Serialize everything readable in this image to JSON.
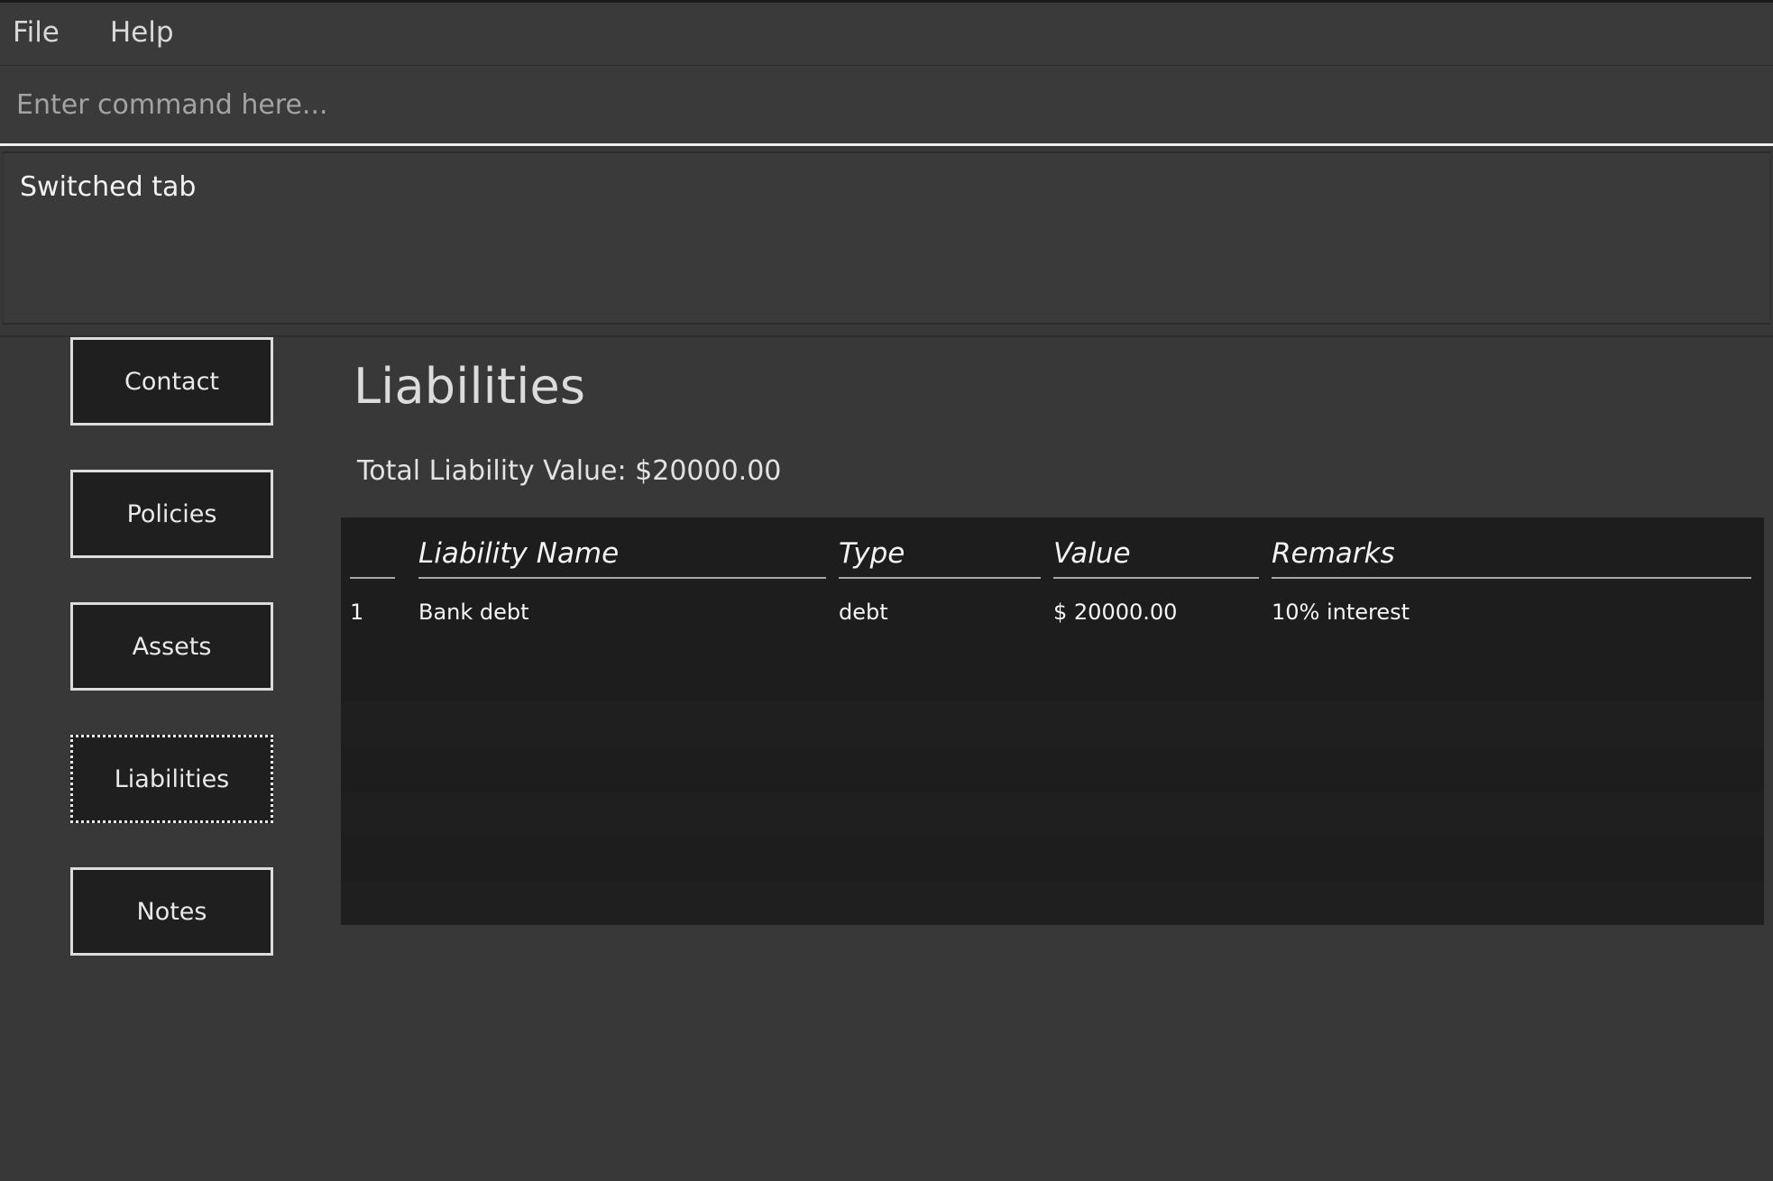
{
  "menubar": {
    "items": [
      {
        "label": "File"
      },
      {
        "label": "Help"
      }
    ]
  },
  "command": {
    "placeholder": "Enter command here...",
    "value": ""
  },
  "result": {
    "text": "Switched tab"
  },
  "sidebar": {
    "items": [
      {
        "label": "Contact",
        "focused": false
      },
      {
        "label": "Policies",
        "focused": false
      },
      {
        "label": "Assets",
        "focused": false
      },
      {
        "label": "Liabilities",
        "focused": true
      },
      {
        "label": "Notes",
        "focused": false
      }
    ]
  },
  "main": {
    "title": "Liabilities",
    "total_label": "Total Liability Value: $20000.00",
    "table": {
      "columns": [
        "",
        "Liability Name",
        "Type",
        "Value",
        "Remarks"
      ],
      "rows": [
        {
          "index": "1",
          "name": "Bank debt",
          "type": "debt",
          "value": "$ 20000.00",
          "remarks": "10% interest"
        }
      ]
    }
  },
  "colors": {
    "window_bg": "#383838",
    "panel_bg": "#1d1d1d",
    "button_bg": "#1f1f1f",
    "button_border": "#dcdcdc",
    "text": "#e9e9e9",
    "accent_rule": "#a8a8a8"
  }
}
